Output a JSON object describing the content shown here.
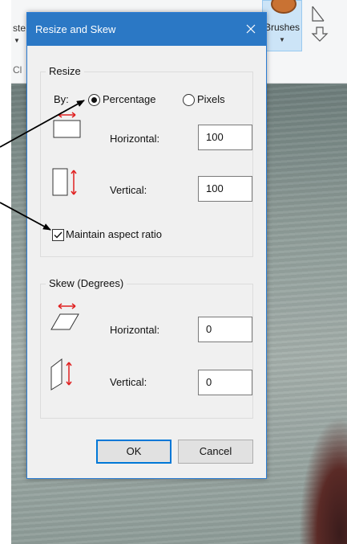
{
  "background_app": {
    "ribbon": {
      "paste_partial": "ste",
      "clipboard_partial": "Cl",
      "brushes_label": "Brushes"
    }
  },
  "dialog": {
    "title": "Resize and Skew",
    "close_glyph": "X",
    "resize": {
      "legend": "Resize",
      "by_label": "By:",
      "percentage_label": "Percentage",
      "percentage_selected": true,
      "pixels_label": "Pixels",
      "pixels_selected": false,
      "horizontal_label": "Horizontal:",
      "horizontal_value": "100",
      "vertical_label": "Vertical:",
      "vertical_value": "100",
      "maintain_aspect_label": "Maintain aspect ratio",
      "maintain_aspect_checked": true
    },
    "skew": {
      "legend": "Skew (Degrees)",
      "horizontal_label": "Horizontal:",
      "horizontal_value": "0",
      "vertical_label": "Vertical:",
      "vertical_value": "0"
    },
    "ok_label": "OK",
    "cancel_label": "Cancel"
  },
  "colors": {
    "titlebar": "#2b78c5",
    "accent": "#0078d7",
    "resize_arrow_red": "#e02020"
  },
  "icons": [
    "close-icon",
    "resize-horizontal-icon",
    "resize-vertical-icon",
    "skew-horizontal-icon",
    "skew-vertical-icon",
    "annotation-arrow"
  ]
}
